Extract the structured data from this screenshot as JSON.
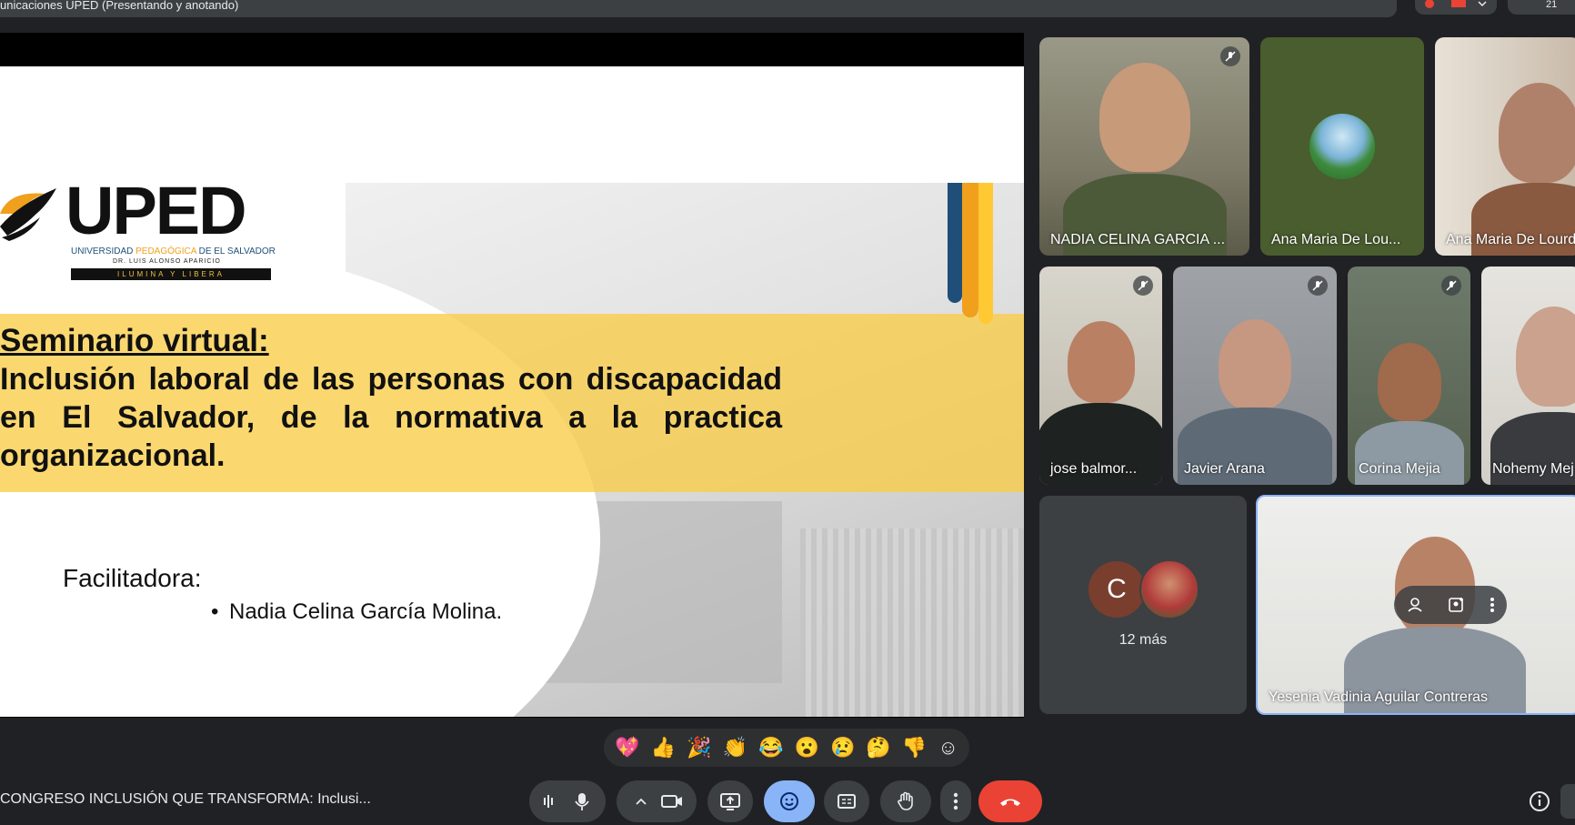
{
  "topbar": {
    "meeting_title": "unicaciones UPED (Presentando y anotando)",
    "participant_count": "21"
  },
  "slide": {
    "logo_name": "UPED",
    "logo_university_pre": "UNIVERSIDAD ",
    "logo_university_mid": "PEDAGÓGICA",
    "logo_university_post": " DE EL SALVADOR",
    "logo_founder": "DR. LUIS ALONSO APARICIO",
    "logo_motto": "ILUMINA Y LIBERA",
    "seminar_heading": "Seminario virtual:",
    "seminar_body": "Inclusión laboral de las personas con discapacidad en El Salvador, de la normativa a la practica organizacional.",
    "facilitator_label": "Facilitadora:",
    "facilitator_name": "Nadia Celina García Molina."
  },
  "participants": [
    {
      "name": "NADIA CELINA GARCIA ...",
      "muted": true
    },
    {
      "name": "Ana Maria De Lou...",
      "muted": false
    },
    {
      "name": "Ana Maria De Lourdes",
      "muted": false
    },
    {
      "name": "jose balmor...",
      "muted": true
    },
    {
      "name": "Javier Arana",
      "muted": true
    },
    {
      "name": "Corina Mejia",
      "muted": true
    },
    {
      "name": "Nohemy Mej",
      "muted": false
    },
    {
      "name": "Yesenia Vadinia Aguilar Contreras",
      "muted": false
    }
  ],
  "more_tile": {
    "initial": "C",
    "label": "12 más"
  },
  "reactions": [
    "💖",
    "👍",
    "🎉",
    "👏",
    "😂",
    "😮",
    "😢",
    "🤔",
    "👎",
    "☺"
  ],
  "bottom": {
    "meeting_name": "CONGRESO INCLUSIÓN QUE TRANSFORMA: Inclusi..."
  },
  "colors": {
    "bg": "#202124",
    "tile": "#3c4043",
    "accent_blue": "#8ab4f8",
    "hangup_red": "#ea4335",
    "slide_yellow": "#facd46"
  }
}
